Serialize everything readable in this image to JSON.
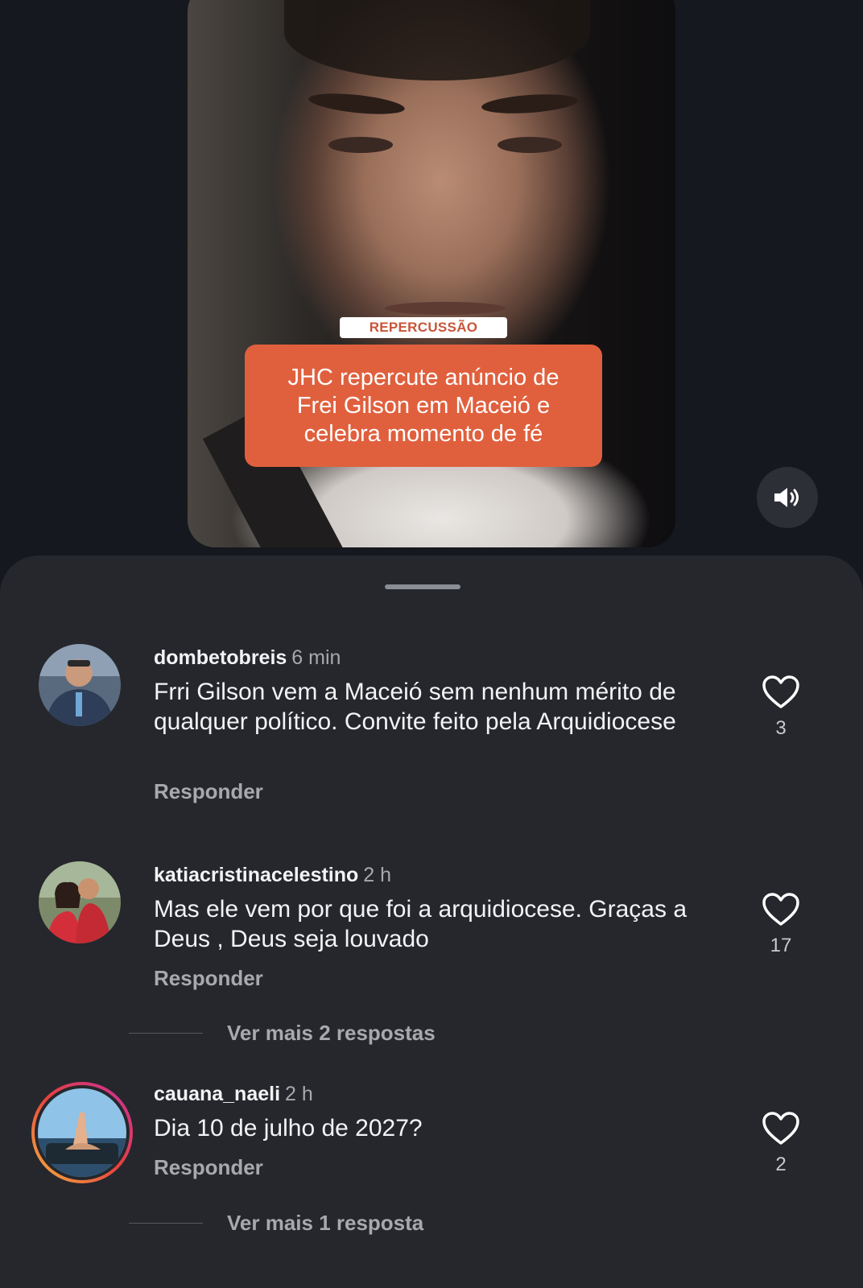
{
  "video": {
    "tag": "REPERCUSSÃO",
    "headline": "JHC repercute anúncio de\nFrei Gilson em Maceió e\ncelebra momento de fé",
    "headline_color": "#e0603e",
    "mute_icon": "speaker-volume-icon"
  },
  "comments": [
    {
      "username": "dombetobreis",
      "time": "6 min",
      "text": "Frri Gilson vem a Maceió sem nenhum mérito de qualquer político.  Convite feito pela Arquidiocese",
      "reply_label": "Responder",
      "likes": "3"
    },
    {
      "username": "katiacristinacelestino",
      "time": "2 h",
      "text": "Mas ele vem por que foi a arquidiocese. Graças a Deus , Deus seja louvado",
      "reply_label": "Responder",
      "likes": "17",
      "more_replies": "Ver mais 2 respostas"
    },
    {
      "username": "cauana_naeli",
      "time": "2 h",
      "text": "Dia 10 de julho de 2027?",
      "reply_label": "Responder",
      "likes": "2",
      "more_replies": "Ver mais 1 resposta",
      "story_ring": true
    }
  ],
  "colors": {
    "background": "#15181e",
    "sheet": "#25272c",
    "muted_text": "#a7a9ae",
    "story_ring_start": "#f5b53f",
    "story_ring_end": "#c8309c"
  }
}
